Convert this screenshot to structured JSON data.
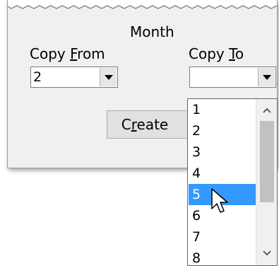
{
  "dialog": {
    "group_title": "Month",
    "copy_from": {
      "label_pre": "Copy ",
      "label_accel": "F",
      "label_post": "rom",
      "value": "2"
    },
    "copy_to": {
      "label_pre": "Copy ",
      "label_accel": "T",
      "label_post": "o",
      "value": ""
    },
    "create_button": {
      "label_pre": "C",
      "label_accel": "r",
      "label_post": "eate"
    }
  },
  "dropdown": {
    "items": [
      "1",
      "2",
      "3",
      "4",
      "5",
      "6",
      "7",
      "8"
    ],
    "selected": "5"
  },
  "icons": {
    "combo_arrow": "chevron-down-icon",
    "scroll_up": "chevron-up-icon",
    "scroll_down": "chevron-down-icon",
    "cursor": "mouse-pointer-icon"
  },
  "colors": {
    "selection": "#3399ff",
    "dialog_bg": "#f0f0f0"
  }
}
